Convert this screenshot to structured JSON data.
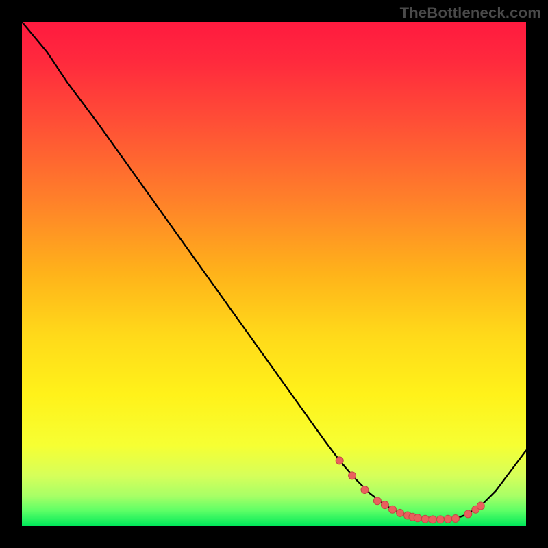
{
  "watermark": "TheBottleneck.com",
  "colors": {
    "gradient_stops": [
      {
        "offset": 0.0,
        "color": "#ff1a3f"
      },
      {
        "offset": 0.08,
        "color": "#ff2a3d"
      },
      {
        "offset": 0.2,
        "color": "#ff4f36"
      },
      {
        "offset": 0.35,
        "color": "#ff7f2a"
      },
      {
        "offset": 0.5,
        "color": "#ffb31a"
      },
      {
        "offset": 0.62,
        "color": "#ffd91a"
      },
      {
        "offset": 0.74,
        "color": "#fff21a"
      },
      {
        "offset": 0.84,
        "color": "#f6ff33"
      },
      {
        "offset": 0.9,
        "color": "#d6ff5a"
      },
      {
        "offset": 0.94,
        "color": "#a8ff66"
      },
      {
        "offset": 0.97,
        "color": "#5cff66"
      },
      {
        "offset": 1.0,
        "color": "#00e85a"
      }
    ],
    "curve": "#000000",
    "marker_fill": "#e9605d",
    "marker_stroke": "#c24946"
  },
  "chart_data": {
    "type": "line",
    "title": "",
    "xlabel": "",
    "ylabel": "",
    "xlim": [
      0,
      100
    ],
    "ylim": [
      0,
      100
    ],
    "grid": false,
    "legend": false,
    "series": [
      {
        "name": "curve",
        "x": [
          0,
          5,
          9,
          15,
          20,
          25,
          30,
          35,
          40,
          45,
          50,
          55,
          60,
          63,
          66,
          69,
          72,
          74,
          76,
          78,
          80,
          82,
          84,
          86,
          88,
          91,
          94,
          97,
          100
        ],
        "y": [
          100,
          94,
          88,
          80,
          73,
          66,
          59,
          52,
          45,
          38,
          31,
          24,
          17,
          13,
          9.5,
          6.5,
          4.2,
          3.0,
          2.2,
          1.7,
          1.4,
          1.3,
          1.3,
          1.5,
          2.2,
          4.0,
          7.0,
          11.0,
          15.0
        ]
      }
    ],
    "markers": [
      {
        "x": 63.0,
        "y": 13.0
      },
      {
        "x": 65.5,
        "y": 10.0
      },
      {
        "x": 68.0,
        "y": 7.2
      },
      {
        "x": 70.5,
        "y": 5.0
      },
      {
        "x": 72.0,
        "y": 4.2
      },
      {
        "x": 73.5,
        "y": 3.3
      },
      {
        "x": 75.0,
        "y": 2.6
      },
      {
        "x": 76.5,
        "y": 2.1
      },
      {
        "x": 77.5,
        "y": 1.8
      },
      {
        "x": 78.5,
        "y": 1.6
      },
      {
        "x": 80.0,
        "y": 1.4
      },
      {
        "x": 81.5,
        "y": 1.3
      },
      {
        "x": 83.0,
        "y": 1.3
      },
      {
        "x": 84.5,
        "y": 1.4
      },
      {
        "x": 86.0,
        "y": 1.5
      },
      {
        "x": 88.5,
        "y": 2.4
      },
      {
        "x": 90.0,
        "y": 3.3
      },
      {
        "x": 91.0,
        "y": 4.0
      }
    ]
  }
}
